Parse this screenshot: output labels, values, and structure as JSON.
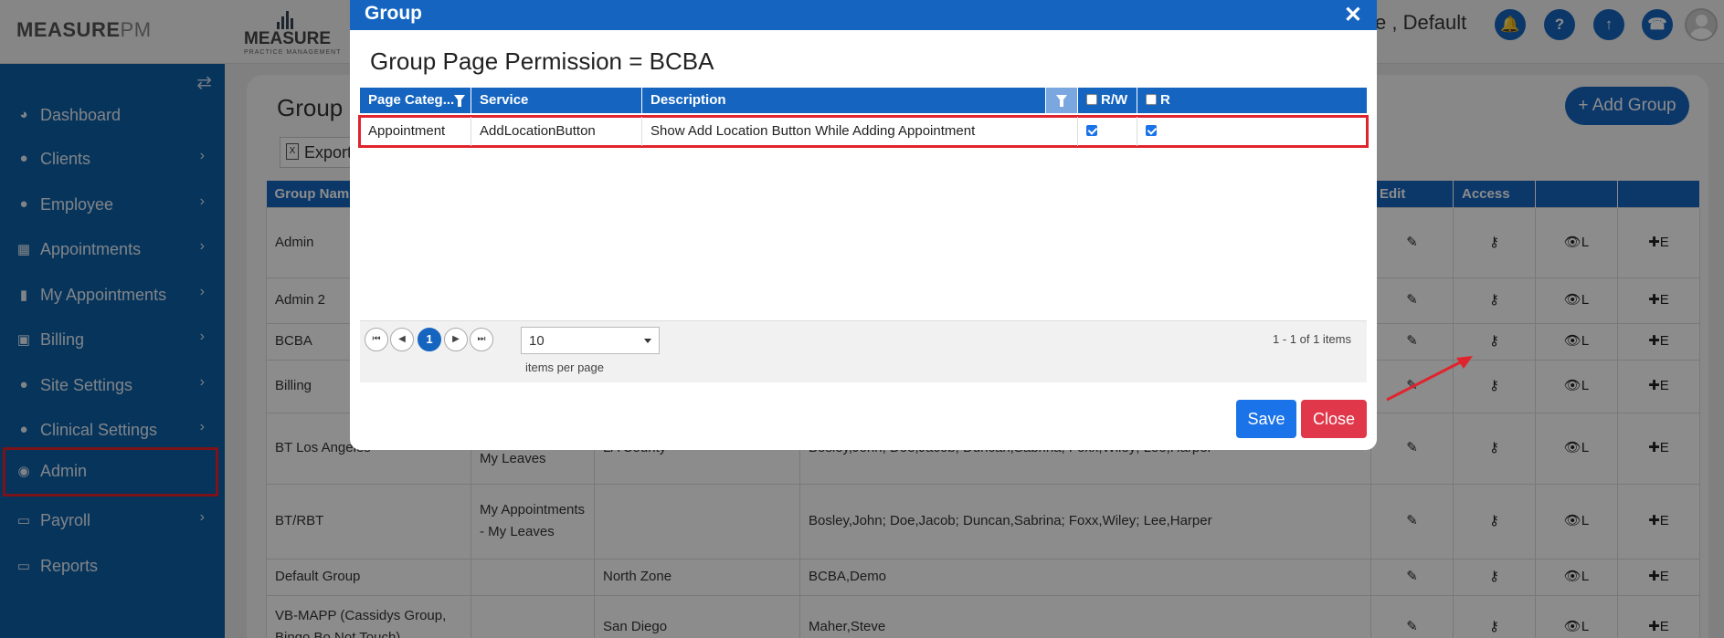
{
  "header": {
    "logo_text": "MEASURE",
    "logo_suffix": "PM",
    "practice_logo_text": "MEASURE",
    "practice_logo_tagline": "PRACTICE MANAGEMENT",
    "title_fragment": "e , Default",
    "icons": [
      "bell-icon",
      "help-icon",
      "upload-icon",
      "phone-icon",
      "user-avatar"
    ]
  },
  "sidebar": {
    "items": [
      {
        "label": "Dashboard",
        "icon": "dashboard-icon",
        "chevron": false
      },
      {
        "label": "Clients",
        "icon": "user-icon",
        "chevron": true
      },
      {
        "label": "Employee",
        "icon": "users-icon",
        "chevron": true
      },
      {
        "label": "Appointments",
        "icon": "calendar-icon",
        "chevron": true
      },
      {
        "label": "My Appointments",
        "icon": "book-icon",
        "chevron": true
      },
      {
        "label": "Billing",
        "icon": "money-icon",
        "chevron": true
      },
      {
        "label": "Site Settings",
        "icon": "user-icon",
        "chevron": true
      },
      {
        "label": "Clinical Settings",
        "icon": "user-icon",
        "chevron": true
      },
      {
        "label": "Admin",
        "icon": "user-circle-icon",
        "chevron": false,
        "active": true
      },
      {
        "label": "Payroll",
        "icon": "card-icon",
        "chevron": true
      },
      {
        "label": "Reports",
        "icon": "card-icon",
        "chevron": false
      }
    ]
  },
  "main": {
    "title": "Group",
    "export_label": "Export",
    "add_group_label": "Add Group",
    "table": {
      "headers": [
        "Group Nam",
        "",
        "",
        "",
        "Edit",
        "Access",
        "",
        ""
      ],
      "rows": [
        {
          "name": "Admin",
          "col2": "",
          "col3": "",
          "col4": ""
        },
        {
          "name": "Admin 2",
          "col2": "",
          "col3": "",
          "col4": ""
        },
        {
          "name": "BCBA",
          "col2": "",
          "col3": "",
          "col4": ""
        },
        {
          "name": "Billing",
          "col2": "",
          "col3": "",
          "col4": ""
        },
        {
          "name": "BT Los Angeles",
          "col2": "Appointments - My Leaves",
          "col3": "LA County",
          "col4": "Bosley,John; Doe,Jacob; Duncan,Sabrina; Foxx,Wiley; Lee,Harper"
        },
        {
          "name": "BT/RBT",
          "col2": "My Appointments - My Leaves",
          "col3": "",
          "col4": "Bosley,John; Doe,Jacob; Duncan,Sabrina; Foxx,Wiley; Lee,Harper"
        },
        {
          "name": "Default Group",
          "col2": "",
          "col3": "North Zone",
          "col4": "BCBA,Demo"
        },
        {
          "name": "VB-MAPP (Cassidys Group, Bingo Bo Not Touch)",
          "col2": "",
          "col3": "San Diego",
          "col4": "Maher,Steve"
        }
      ],
      "view_label": "👁L",
      "add_label": "✚E"
    }
  },
  "modal": {
    "title": "Group",
    "close_glyph": "✕",
    "heading": "Group Page Permission = BCBA",
    "grid": {
      "columns": [
        "Page Categ...",
        "Service",
        "Description",
        "R/W",
        "R"
      ],
      "rows": [
        {
          "category": "Appointment",
          "service": "AddLocationButton",
          "description": "Show Add Location Button While Adding Appointment",
          "rw": true,
          "r": true
        }
      ]
    },
    "pager": {
      "current_page": "1",
      "page_size": "10",
      "items_per_page_label": "items per page",
      "info": "1 - 1 of 1 items"
    },
    "save_label": "Save",
    "close_label": "Close"
  },
  "colors": {
    "primary": "#1565c0",
    "sidebar": "#0d5fa6",
    "danger": "#e0384a",
    "highlight": "#e0242e"
  }
}
